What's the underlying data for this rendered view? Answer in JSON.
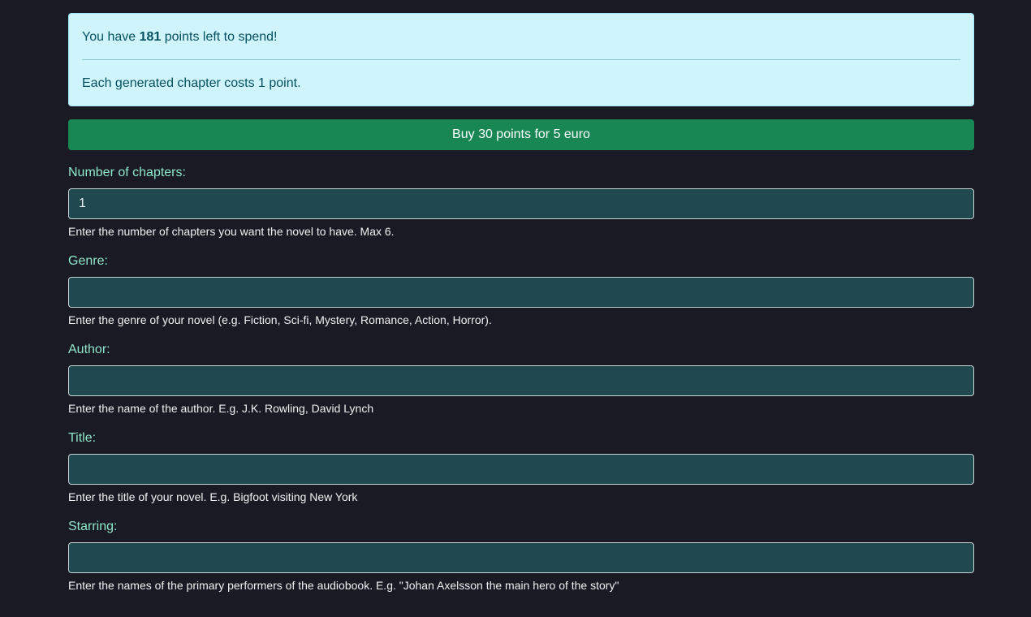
{
  "info": {
    "prefix": "You have ",
    "points": "181",
    "suffix": " points left to spend!",
    "cost_note": "Each generated chapter costs 1 point."
  },
  "buy_button_label": "Buy 30 points for 5 euro",
  "fields": [
    {
      "label": "Number of chapters:",
      "value": "1",
      "help": "Enter the number of chapters you want the novel to have. Max 6."
    },
    {
      "label": "Genre:",
      "value": "",
      "help": "Enter the genre of your novel (e.g. Fiction, Sci-fi, Mystery, Romance, Action, Horror)."
    },
    {
      "label": "Author:",
      "value": "",
      "help": "Enter the name of the author. E.g. J.K. Rowling, David Lynch"
    },
    {
      "label": "Title:",
      "value": "",
      "help": "Enter the title of your novel. E.g. Bigfoot visiting New York"
    },
    {
      "label": "Starring:",
      "value": "",
      "help": "Enter the names of the primary performers of the audiobook. E.g. \"Johan Axelsson the main hero of the story\""
    }
  ]
}
